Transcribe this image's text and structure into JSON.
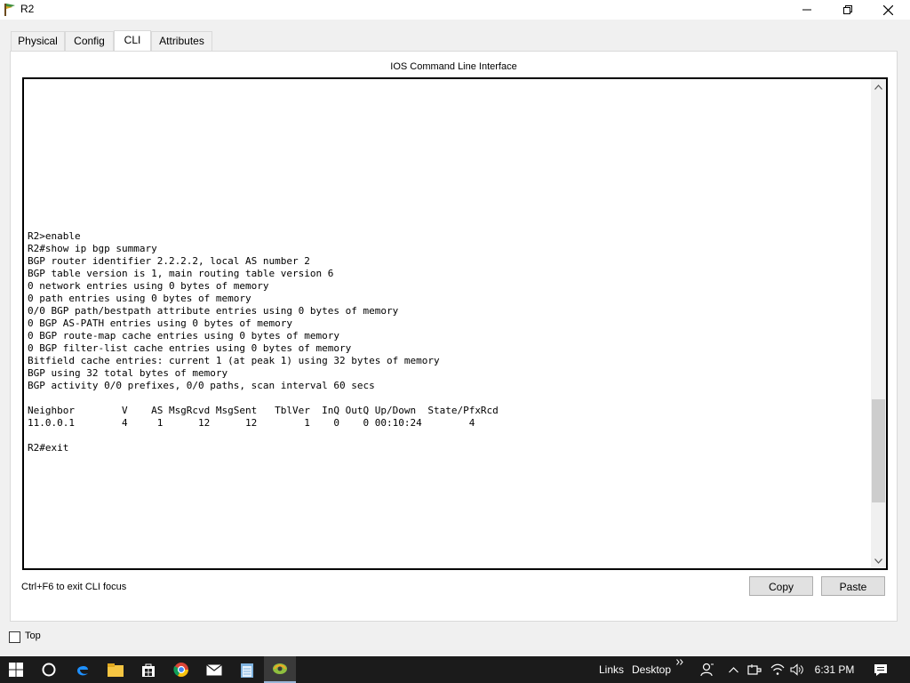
{
  "window": {
    "title": "R2"
  },
  "tabs": [
    {
      "label": "Physical"
    },
    {
      "label": "Config"
    },
    {
      "label": "CLI"
    },
    {
      "label": "Attributes"
    }
  ],
  "cli": {
    "header": "IOS Command Line Interface",
    "lines": [
      "R2>enable",
      "R2#show ip bgp summary",
      "BGP router identifier 2.2.2.2, local AS number 2",
      "BGP table version is 1, main routing table version 6",
      "0 network entries using 0 bytes of memory",
      "0 path entries using 0 bytes of memory",
      "0/0 BGP path/bestpath attribute entries using 0 bytes of memory",
      "0 BGP AS-PATH entries using 0 bytes of memory",
      "0 BGP route-map cache entries using 0 bytes of memory",
      "0 BGP filter-list cache entries using 0 bytes of memory",
      "Bitfield cache entries: current 1 (at peak 1) using 32 bytes of memory",
      "BGP using 32 total bytes of memory",
      "BGP activity 0/0 prefixes, 0/0 paths, scan interval 60 secs",
      "",
      "Neighbor        V    AS MsgRcvd MsgSent   TblVer  InQ OutQ Up/Down  State/PfxRcd",
      "11.0.0.1        4     1      12      12        1    0    0 00:10:24        4",
      "",
      "R2#exit"
    ],
    "focus_hint": "Ctrl+F6 to exit CLI focus",
    "copy_label": "Copy",
    "paste_label": "Paste"
  },
  "top_checkbox": {
    "label": "Top",
    "checked": false
  },
  "taskbar": {
    "links_label": "Links",
    "desktop_label": "Desktop",
    "clock": "6:31 PM",
    "icons": [
      "windows-start-icon",
      "cortana-icon",
      "edge-icon",
      "file-explorer-icon",
      "store-icon",
      "chrome-icon",
      "mail-icon",
      "notepad-icon",
      "packet-tracer-icon"
    ]
  }
}
